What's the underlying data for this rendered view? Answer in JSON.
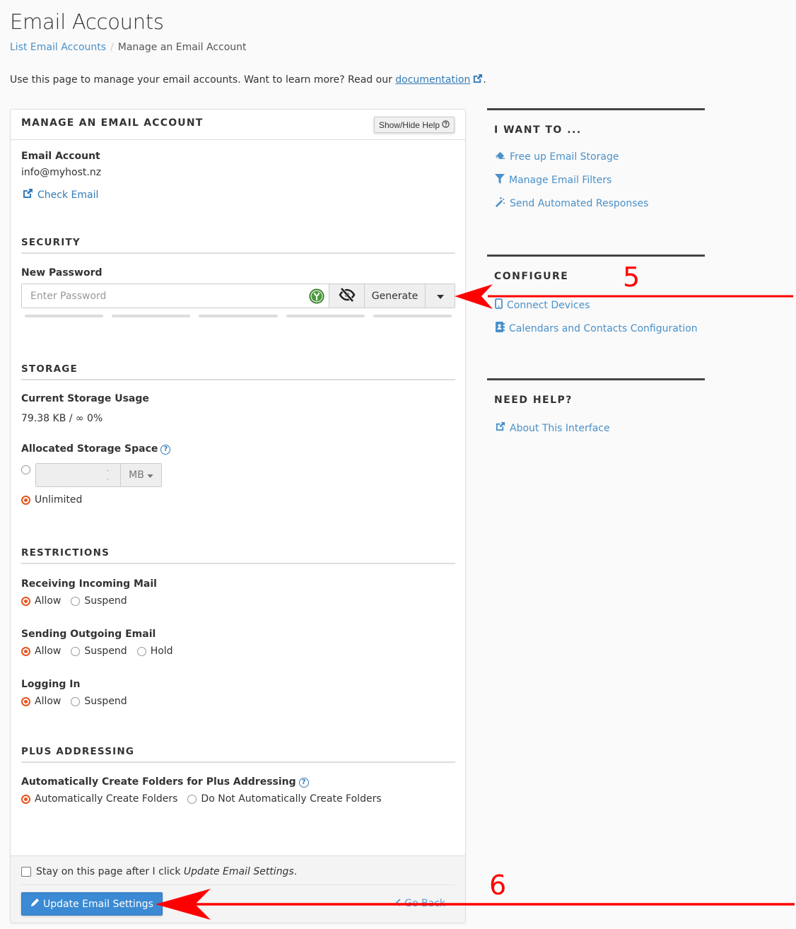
{
  "header": {
    "title": "Email Accounts",
    "breadcrumb": {
      "parent": "List Email Accounts",
      "separator": "/",
      "current": "Manage an Email Account"
    },
    "intro_text": "Use this page to manage your email accounts. Want to learn more? Read our ",
    "intro_link": "documentation",
    "intro_end": "."
  },
  "panel": {
    "title": "MANAGE AN EMAIL ACCOUNT",
    "help_button": "Show/Hide Help",
    "email_account_label": "Email Account",
    "email_account_value": "info@myhost.nz",
    "check_email_link": "Check Email",
    "security": {
      "title": "SECURITY",
      "new_password_label": "New Password",
      "password_placeholder": "Enter Password",
      "password_value": "",
      "generate_button": "Generate",
      "strength_segments": 5,
      "strength_filled": 0
    },
    "storage": {
      "title": "STORAGE",
      "current_usage_label": "Current Storage Usage",
      "current_usage_value": "79.38 KB / ∞ 0%",
      "allocated_label": "Allocated Storage Space",
      "quota_value": "",
      "quota_unit": "MB",
      "unlimited_label": "Unlimited",
      "selected": "unlimited"
    },
    "restrictions": {
      "title": "RESTRICTIONS",
      "groups": [
        {
          "label": "Receiving Incoming Mail",
          "options": [
            "Allow",
            "Suspend"
          ],
          "selected": "Allow"
        },
        {
          "label": "Sending Outgoing Email",
          "options": [
            "Allow",
            "Suspend",
            "Hold"
          ],
          "selected": "Allow"
        },
        {
          "label": "Logging In",
          "options": [
            "Allow",
            "Suspend"
          ],
          "selected": "Allow"
        }
      ]
    },
    "plus_addressing": {
      "title": "PLUS ADDRESSING",
      "label": "Automatically Create Folders for Plus Addressing",
      "options": [
        "Automatically Create Folders",
        "Do Not Automatically Create Folders"
      ],
      "selected": "Automatically Create Folders"
    },
    "footer": {
      "stay_text": "Stay on this page after I click ",
      "stay_em": "Update Email Settings",
      "stay_end": ".",
      "stay_checked": false,
      "update_button": "Update Email Settings",
      "go_back": "Go Back"
    }
  },
  "sidebar": {
    "sections": [
      {
        "title": "I WANT TO ...",
        "links": [
          {
            "label": "Free up Email Storage",
            "icon": "eraser-icon"
          },
          {
            "label": "Manage Email Filters",
            "icon": "filter-icon"
          },
          {
            "label": "Send Automated Responses",
            "icon": "magic-wand-icon"
          }
        ]
      },
      {
        "title": "CONFIGURE",
        "links": [
          {
            "label": "Connect Devices",
            "icon": "mobile-icon"
          },
          {
            "label": "Calendars and Contacts Configuration",
            "icon": "address-book-icon"
          }
        ]
      },
      {
        "title": "NEED HELP?",
        "links": [
          {
            "label": "About This Interface",
            "icon": "external-link-icon"
          }
        ]
      }
    ]
  },
  "annotations": [
    {
      "number": "5",
      "target": "password-options-dropdown",
      "color": "#ff0000"
    },
    {
      "number": "6",
      "target": "update-email-settings-button",
      "color": "#ff0000"
    }
  ]
}
